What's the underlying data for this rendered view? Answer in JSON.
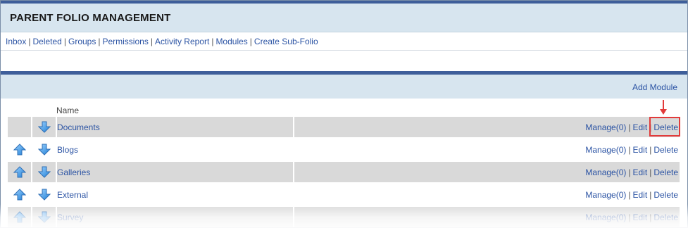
{
  "header": {
    "title": "PARENT FOLIO MANAGEMENT"
  },
  "nav": [
    {
      "label": "Inbox"
    },
    {
      "label": "Deleted"
    },
    {
      "label": "Groups"
    },
    {
      "label": "Permissions"
    },
    {
      "label": "Activity Report"
    },
    {
      "label": "Modules"
    },
    {
      "label": "Create Sub-Folio"
    }
  ],
  "nav_separator": "|",
  "section": {
    "add_module_label": "Add Module"
  },
  "table": {
    "name_header": "Name",
    "rows": [
      {
        "name": "Documents",
        "manage": "Manage(0)",
        "edit": "Edit",
        "delete": "Delete",
        "has_up": false,
        "has_down": true,
        "shaded": true
      },
      {
        "name": "Blogs",
        "manage": "Manage(0)",
        "edit": "Edit",
        "delete": "Delete",
        "has_up": true,
        "has_down": true,
        "shaded": false
      },
      {
        "name": "Galleries",
        "manage": "Manage(0)",
        "edit": "Edit",
        "delete": "Delete",
        "has_up": true,
        "has_down": true,
        "shaded": true
      },
      {
        "name": "External",
        "manage": "Manage(0)",
        "edit": "Edit",
        "delete": "Delete",
        "has_up": true,
        "has_down": true,
        "shaded": false
      },
      {
        "name": "Survey",
        "manage": "Manage(0)",
        "edit": "Edit",
        "delete": "Delete",
        "has_up": true,
        "has_down": true,
        "shaded": true
      }
    ]
  },
  "colors": {
    "link": "#2c54a4",
    "header_bg": "#d7e5ef",
    "accent_bar": "#3e5e9a",
    "row_shade": "#d9d9d9",
    "annotation": "#e23b3b"
  }
}
